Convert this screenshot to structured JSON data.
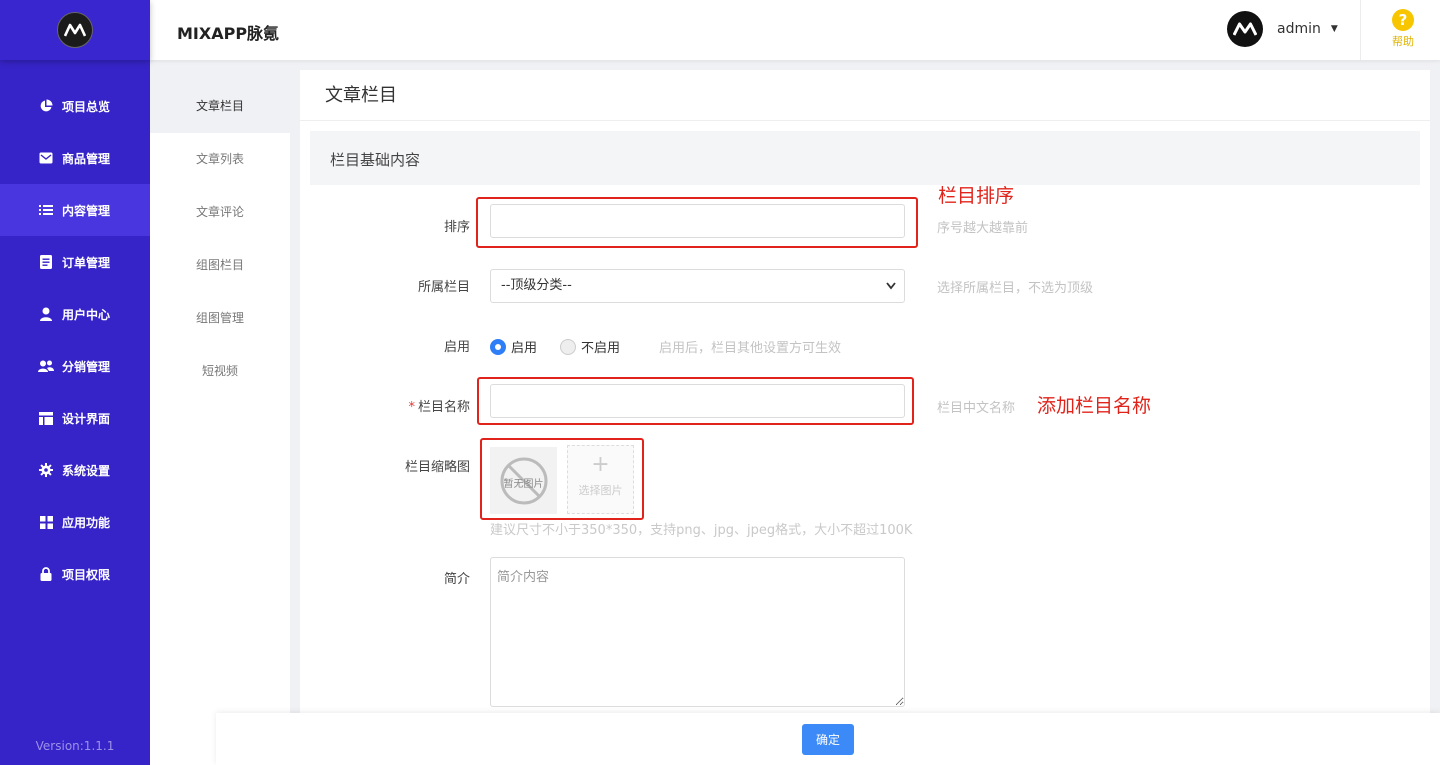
{
  "app": {
    "title": "MIXAPP脉氪",
    "version": "Version:1.1.1"
  },
  "header": {
    "username": "admin",
    "help_label": "帮助",
    "help_symbol": "?"
  },
  "sidebar": {
    "items": [
      {
        "label": "项目总览",
        "icon": "pie-chart-icon"
      },
      {
        "label": "商品管理",
        "icon": "envelope-icon"
      },
      {
        "label": "内容管理",
        "icon": "list-icon",
        "active": true
      },
      {
        "label": "订单管理",
        "icon": "document-icon"
      },
      {
        "label": "用户中心",
        "icon": "user-icon"
      },
      {
        "label": "分销管理",
        "icon": "users-icon"
      },
      {
        "label": "设计界面",
        "icon": "layout-icon"
      },
      {
        "label": "系统设置",
        "icon": "gear-icon"
      },
      {
        "label": "应用功能",
        "icon": "grid-icon"
      },
      {
        "label": "项目权限",
        "icon": "lock-icon"
      }
    ]
  },
  "subnav": {
    "items": [
      {
        "label": "文章栏目",
        "active": true
      },
      {
        "label": "文章列表"
      },
      {
        "label": "文章评论"
      },
      {
        "label": "组图栏目"
      },
      {
        "label": "组图管理"
      },
      {
        "label": "短视频"
      }
    ]
  },
  "main": {
    "page_title": "文章栏目",
    "section_title": "栏目基础内容",
    "form": {
      "sort": {
        "label": "排序",
        "value": "",
        "hint": "序号越大越靠前"
      },
      "parent": {
        "label": "所属栏目",
        "selected": "--顶级分类--",
        "hint": "选择所属栏目，不选为顶级"
      },
      "enable": {
        "label": "启用",
        "option_on": "启用",
        "option_off": "不启用",
        "selected": "启用",
        "hint": "启用后，栏目其他设置方可生效"
      },
      "name": {
        "label": "栏目名称",
        "required_mark": "*",
        "value": "",
        "hint": "栏目中文名称"
      },
      "thumb": {
        "label": "栏目缩略图",
        "empty_text": "暂无图片",
        "pick_label": "选择图片",
        "pick_plus": "+",
        "size_hint": "建议尺寸不小于350*350，支持png、jpg、jpeg格式，大小不超过100K"
      },
      "intro": {
        "label": "简介",
        "placeholder": "简介内容",
        "value": ""
      }
    },
    "annotations": {
      "sort_note": "栏目排序",
      "name_note": "添加栏目名称"
    }
  },
  "footer": {
    "confirm_label": "确定"
  },
  "colors": {
    "sidebar": "#3724c9",
    "primary": "#3c8af7",
    "annotation": "#e0241b",
    "help": "#f7c600"
  }
}
